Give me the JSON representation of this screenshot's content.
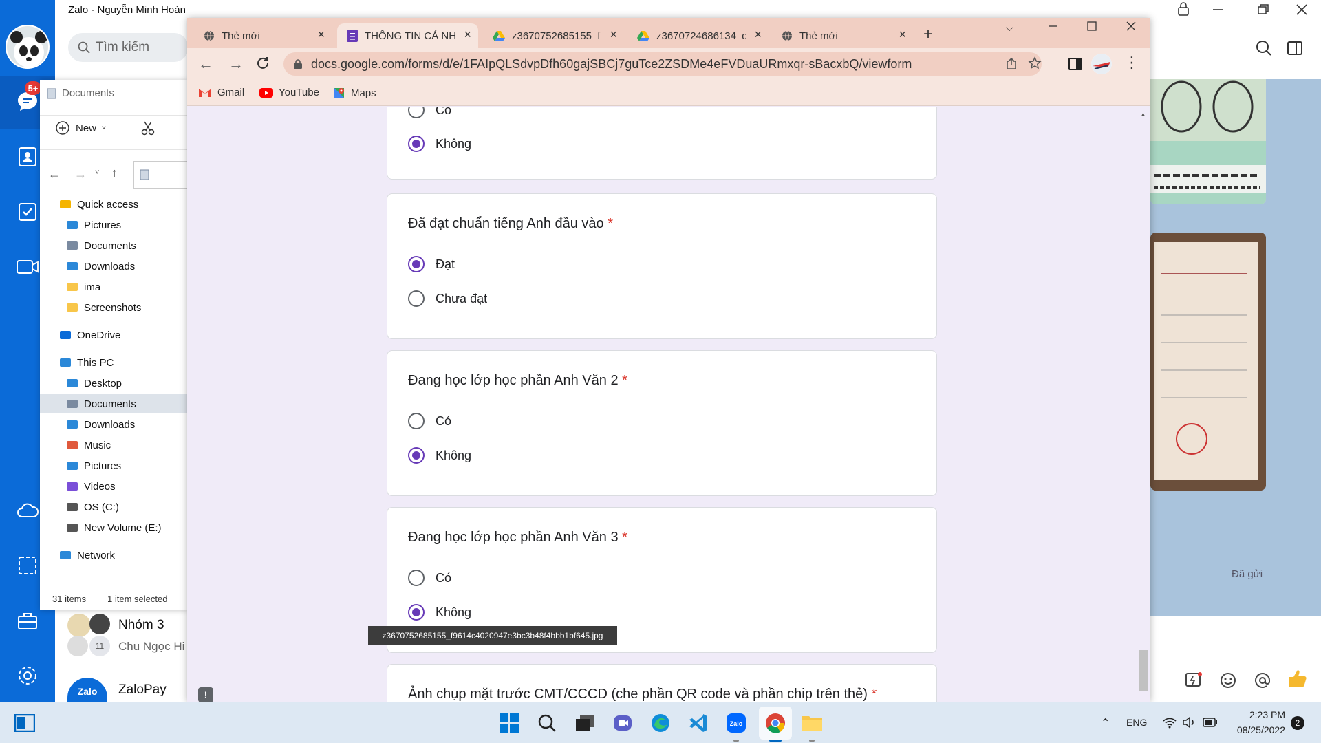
{
  "zalo": {
    "window_title": "Zalo - Nguyễn Minh Hoàn",
    "search_placeholder": "Tìm kiếm",
    "notification_count": "5+",
    "sent_status": "Đã gửi",
    "conversations": [
      {
        "name": "Nhóm 3",
        "preview": "Chu Ngọc Hi",
        "member_count": "11"
      },
      {
        "name": "ZaloPay",
        "logo_text": "Zalo"
      }
    ]
  },
  "explorer": {
    "title": "Documents",
    "new_label": "New",
    "tree": [
      {
        "label": "Quick access",
        "icon": "star-icon"
      },
      {
        "label": "Pictures",
        "icon": "pictures-icon"
      },
      {
        "label": "Documents",
        "icon": "documents-icon"
      },
      {
        "label": "Downloads",
        "icon": "download-icon"
      },
      {
        "label": "ima",
        "icon": "folder-icon"
      },
      {
        "label": "Screenshots",
        "icon": "folder-icon"
      },
      {
        "label": "OneDrive",
        "icon": "cloud-icon"
      },
      {
        "label": "This PC",
        "icon": "pc-icon"
      },
      {
        "label": "Desktop",
        "icon": "desktop-icon"
      },
      {
        "label": "Documents",
        "icon": "documents-icon"
      },
      {
        "label": "Downloads",
        "icon": "download-icon"
      },
      {
        "label": "Music",
        "icon": "music-icon"
      },
      {
        "label": "Pictures",
        "icon": "pictures-icon"
      },
      {
        "label": "Videos",
        "icon": "videos-icon"
      },
      {
        "label": "OS (C:)",
        "icon": "drive-icon"
      },
      {
        "label": "New Volume (E:)",
        "icon": "drive-icon"
      },
      {
        "label": "Network",
        "icon": "network-icon"
      }
    ],
    "status_items": "31 items",
    "status_selected": "1 item selected"
  },
  "chrome": {
    "tabs": [
      {
        "label": "Thẻ mới",
        "icon": "globe-icon"
      },
      {
        "label": "THÔNG TIN CÁ NH",
        "icon": "forms-icon"
      },
      {
        "label": "z3670752685155_f",
        "icon": "drive-icon"
      },
      {
        "label": "z3670724686134_d",
        "icon": "drive-icon"
      },
      {
        "label": "Thẻ mới",
        "icon": "globe-icon"
      }
    ],
    "url": "docs.google.com/forms/d/e/1FAIpQLSdvpDfh60gajSBCj7guTce2ZSDMe4eFVDuaURmxqr-sBacxbQ/viewform",
    "bookmarks": [
      "Gmail",
      "YouTube",
      "Maps"
    ]
  },
  "form": {
    "q0": {
      "partial_option": "Có",
      "selected_option": "Không"
    },
    "q1": {
      "title": "Đã đạt chuẩn tiếng Anh đầu vào",
      "options": [
        "Đạt",
        "Chưa đạt"
      ],
      "selected": "Đạt"
    },
    "q2": {
      "title": "Đang học lớp học phần Anh Văn 2",
      "options": [
        "Có",
        "Không"
      ],
      "selected": "Không"
    },
    "q3": {
      "title": "Đang học lớp học phần Anh Văn 3",
      "options": [
        "Có",
        "Không"
      ],
      "selected": "Không"
    },
    "q4": {
      "title": "Ảnh chụp mặt trước CMT/CCCD (che phần QR code và phần chip trên thẻ)"
    },
    "required_mark": "*"
  },
  "tooltip": "z3670752685155_f9614c4020947e3bc3b48f4bbb1bf645.jpg",
  "taskbar": {
    "language": "ENG",
    "time": "2:23 PM",
    "date": "08/25/2022",
    "notification_count": "2"
  }
}
